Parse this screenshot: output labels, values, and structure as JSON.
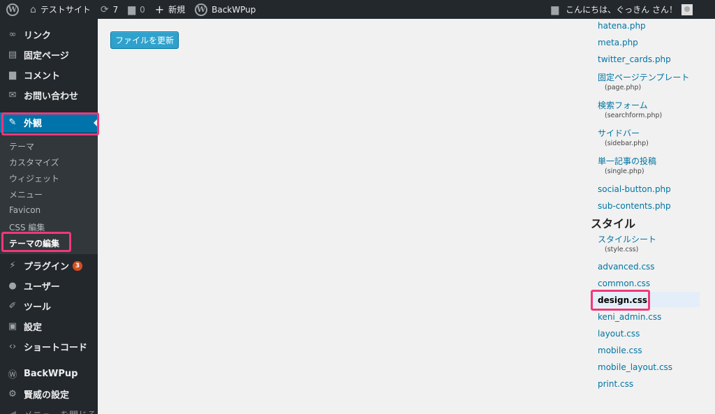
{
  "adminbar": {
    "site_name": "テストサイト",
    "updates_count": "7",
    "comments_count": "0",
    "new_label": "新規",
    "plugin_label": "BackWPup",
    "greeting": "こんにちは、ぐっきん さん！"
  },
  "sidebar": {
    "top_partial": "",
    "items": [
      {
        "label": "リンク",
        "icon": "link-icon"
      },
      {
        "label": "固定ページ",
        "icon": "pages-icon"
      },
      {
        "label": "コメント",
        "icon": "comments-icon"
      },
      {
        "label": "お問い合わせ",
        "icon": "mail-icon"
      },
      {
        "label": "外観",
        "icon": "appearance-icon"
      }
    ],
    "appearance_submenu": [
      "テーマ",
      "カスタマイズ",
      "ウィジェット",
      "メニュー",
      "Favicon",
      "CSS 編集",
      "テーマの編集"
    ],
    "items_after": [
      {
        "label": "プラグイン",
        "icon": "plugins-icon",
        "badge": "3"
      },
      {
        "label": "ユーザー",
        "icon": "users-icon"
      },
      {
        "label": "ツール",
        "icon": "tools-icon"
      },
      {
        "label": "設定",
        "icon": "settings-icon"
      },
      {
        "label": "ショートコード",
        "icon": "shortcode-icon"
      },
      {
        "label": "BackWPup",
        "icon": "backwpup-icon"
      },
      {
        "label": "賢威の設定",
        "icon": "gear-icon"
      },
      {
        "label": "メニューを閉じる",
        "icon": "collapse-icon"
      }
    ]
  },
  "main": {
    "update_button": "ファイルを更新"
  },
  "files": {
    "templates": [
      {
        "label": "hatena.php"
      },
      {
        "label": "meta.php"
      },
      {
        "label": "twitter_cards.php"
      },
      {
        "label": "固定ページテンプレート",
        "file": "(page.php)"
      },
      {
        "label": "検索フォーム",
        "file": "(searchform.php)"
      },
      {
        "label": "サイドバー",
        "file": "(sidebar.php)"
      },
      {
        "label": "単一記事の投稿",
        "file": "(single.php)"
      },
      {
        "label": "social-button.php"
      },
      {
        "label": "sub-contents.php"
      }
    ],
    "styles_heading": "スタイル",
    "styles": [
      {
        "label": "スタイルシート",
        "file": "(style.css)"
      },
      {
        "label": "advanced.css"
      },
      {
        "label": "common.css"
      },
      {
        "label": "design.css"
      },
      {
        "label": "keni_admin.css"
      },
      {
        "label": "layout.css"
      },
      {
        "label": "mobile.css"
      },
      {
        "label": "mobile_layout.css"
      },
      {
        "label": "print.css"
      }
    ]
  },
  "colors": {
    "adminbar_bg": "#23282d",
    "menu_current_bg": "#0073aa",
    "button_bg": "#2ea2cc",
    "highlight_border": "#f0387a",
    "link": "#0074a2"
  }
}
